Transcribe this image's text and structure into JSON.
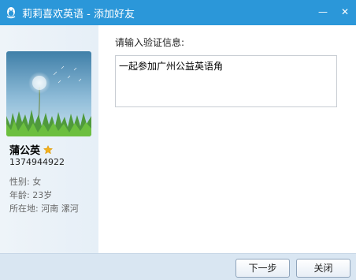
{
  "window": {
    "title": "莉莉喜欢英语 - 添加好友",
    "minimize_glyph": "—",
    "close_glyph": "✕"
  },
  "profile": {
    "nickname": "蒲公英",
    "qq_number": "1374944922",
    "gender": "性别: 女",
    "age": "年龄: 23岁",
    "location": "所在地: 河南  漯河"
  },
  "form": {
    "prompt": "请输入验证信息:",
    "message": "一起参加广州公益英语角"
  },
  "buttons": {
    "next": "下一步",
    "close": "关闭"
  },
  "colors": {
    "titlebar": "#2b97d9",
    "footer": "#d9e6f2",
    "star": "#f2b01e"
  }
}
